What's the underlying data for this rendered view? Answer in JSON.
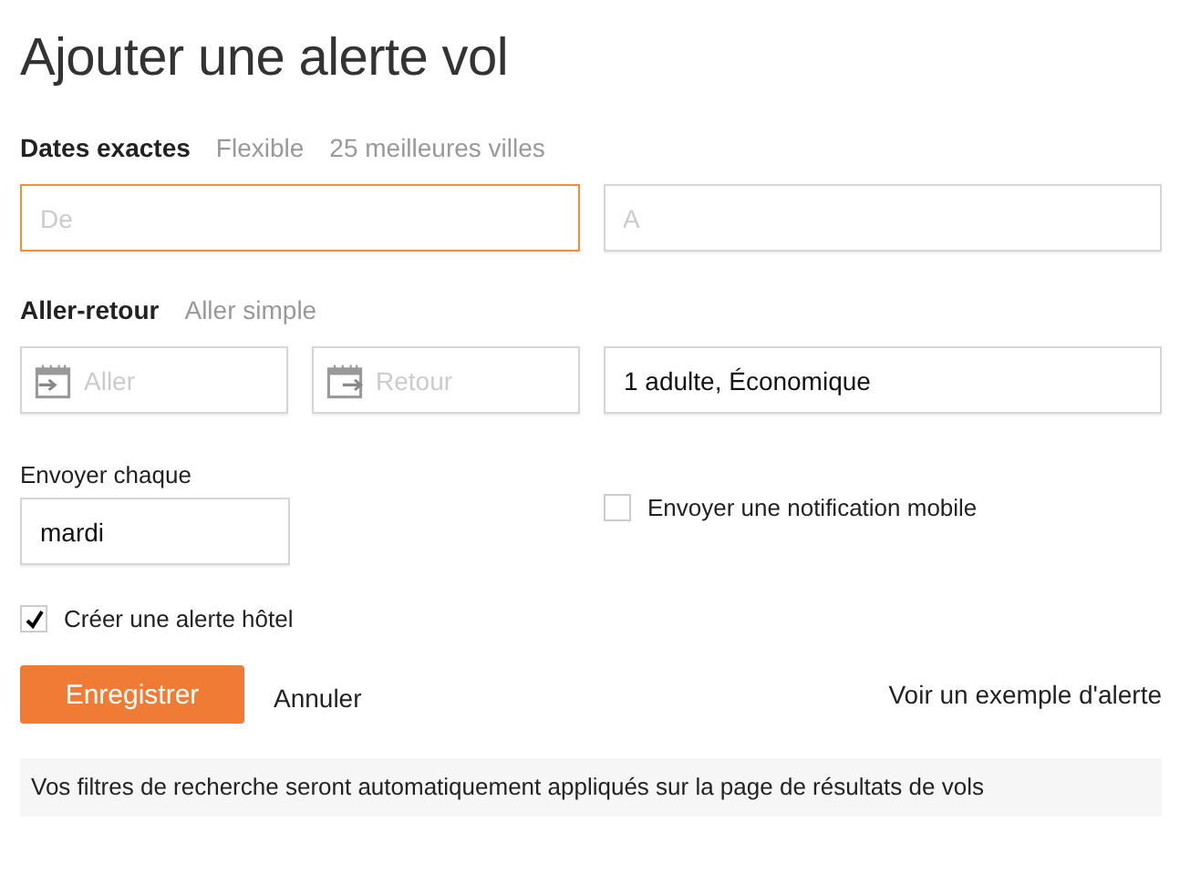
{
  "title": "Ajouter une alerte vol",
  "date_tabs": [
    {
      "label": "Dates exactes",
      "selected": true
    },
    {
      "label": "Flexible",
      "selected": false
    },
    {
      "label": "25 meilleures villes",
      "selected": false
    }
  ],
  "date_fields": [
    {
      "placeholder": "De",
      "focused": true
    },
    {
      "placeholder": "A",
      "focused": false
    }
  ],
  "trip_tabs": [
    {
      "label": "Aller-retour",
      "selected": true
    },
    {
      "label": "Aller simple",
      "selected": false
    }
  ],
  "trip_dates": [
    {
      "placeholder": "Aller",
      "kind": "depart"
    },
    {
      "placeholder": "Retour",
      "kind": "return"
    }
  ],
  "travelers": {
    "value": "1 adulte, Économique"
  },
  "frequency": {
    "label": "Envoyer chaque",
    "value": "mardi"
  },
  "mobile_notification": {
    "label": "Envoyer une notification mobile",
    "checked": false
  },
  "hotel_alert": {
    "label": "Créer une alerte hôtel",
    "checked": true
  },
  "buttons": {
    "save": "Enregistrer",
    "cancel": "Annuler"
  },
  "example_link": "Voir un exemple d'alerte",
  "info": "Vos filtres de recherche seront automatiquement appliqués sur la page de résultats de vols"
}
